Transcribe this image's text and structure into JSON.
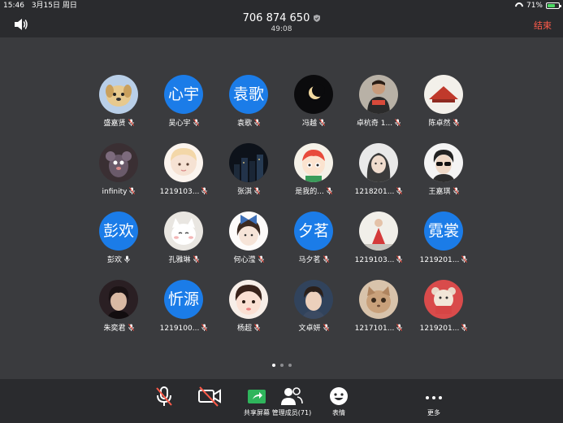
{
  "status_bar": {
    "time": "15:46",
    "date": "3月15日 周日",
    "battery_percent": "71%",
    "battery_level": 0.71,
    "battery_color": "#4cd964"
  },
  "header": {
    "meeting_id": "706 874 650",
    "timer": "49:08",
    "end_label": "结束",
    "end_color": "#ff5b4a",
    "speaker_icon": "speaker-icon",
    "shield_icon": "shield-icon"
  },
  "participants": [
    {
      "name": "盛嘉贤",
      "avatar_text": "",
      "avatar_kind": "puppy"
    },
    {
      "name": "吴心宇",
      "avatar_text": "心宇",
      "avatar_kind": "text"
    },
    {
      "name": "袁歌",
      "avatar_text": "袁歌",
      "avatar_kind": "text"
    },
    {
      "name": "冯越",
      "avatar_text": "",
      "avatar_kind": "moon"
    },
    {
      "name": "卓杭奇 1...",
      "avatar_text": "",
      "avatar_kind": "person-dark"
    },
    {
      "name": "陈卓然",
      "avatar_text": "",
      "avatar_kind": "red-shape"
    },
    {
      "name": "infinity",
      "avatar_text": "",
      "avatar_kind": "cartoon-rat"
    },
    {
      "name": "1219103...",
      "avatar_text": "",
      "avatar_kind": "anime-girl"
    },
    {
      "name": "张淇",
      "avatar_text": "",
      "avatar_kind": "night-city"
    },
    {
      "name": "是我的...",
      "avatar_text": "",
      "avatar_kind": "cartoon-face"
    },
    {
      "name": "1218201...",
      "avatar_text": "",
      "avatar_kind": "person-light"
    },
    {
      "name": "王嘉琪",
      "avatar_text": "",
      "avatar_kind": "person-sunglasses"
    },
    {
      "name": "彭欢",
      "avatar_text": "彭欢",
      "avatar_kind": "text",
      "mic_on": true
    },
    {
      "name": "孔雅琳",
      "avatar_text": "",
      "avatar_kind": "cartoon-cat"
    },
    {
      "name": "何心滢",
      "avatar_text": "",
      "avatar_kind": "girl-bow"
    },
    {
      "name": "马夕茗",
      "avatar_text": "夕茗",
      "avatar_kind": "text"
    },
    {
      "name": "1219103...",
      "avatar_text": "",
      "avatar_kind": "red-figure"
    },
    {
      "name": "1219201...",
      "avatar_text": "霓裳",
      "avatar_kind": "text"
    },
    {
      "name": "朱奕君",
      "avatar_text": "",
      "avatar_kind": "person-dark2"
    },
    {
      "name": "1219100...",
      "avatar_text": "忻源",
      "avatar_kind": "text"
    },
    {
      "name": "杨超",
      "avatar_text": "",
      "avatar_kind": "girl-face"
    },
    {
      "name": "文卓妍",
      "avatar_text": "",
      "avatar_kind": "man-face"
    },
    {
      "name": "1217101...",
      "avatar_text": "",
      "avatar_kind": "cat-photo"
    },
    {
      "name": "1219201...",
      "avatar_text": "",
      "avatar_kind": "bear-red"
    }
  ],
  "pager": {
    "current": 0,
    "count": 3
  },
  "toolbar": {
    "items": [
      {
        "label": "",
        "icon": "mic-muted-icon"
      },
      {
        "label": "",
        "icon": "video-off-icon"
      },
      {
        "label": "共享屏幕",
        "icon": "share-screen-icon"
      },
      {
        "label": "管理成员(71)",
        "icon": "members-icon"
      },
      {
        "label": "表情",
        "icon": "emoji-icon"
      },
      {
        "label": "更多",
        "icon": "more-icon"
      }
    ]
  },
  "colors": {
    "background": "#3a3b3e",
    "bar": "#2a2b2e",
    "avatar_blue": "#1b7ce8"
  }
}
